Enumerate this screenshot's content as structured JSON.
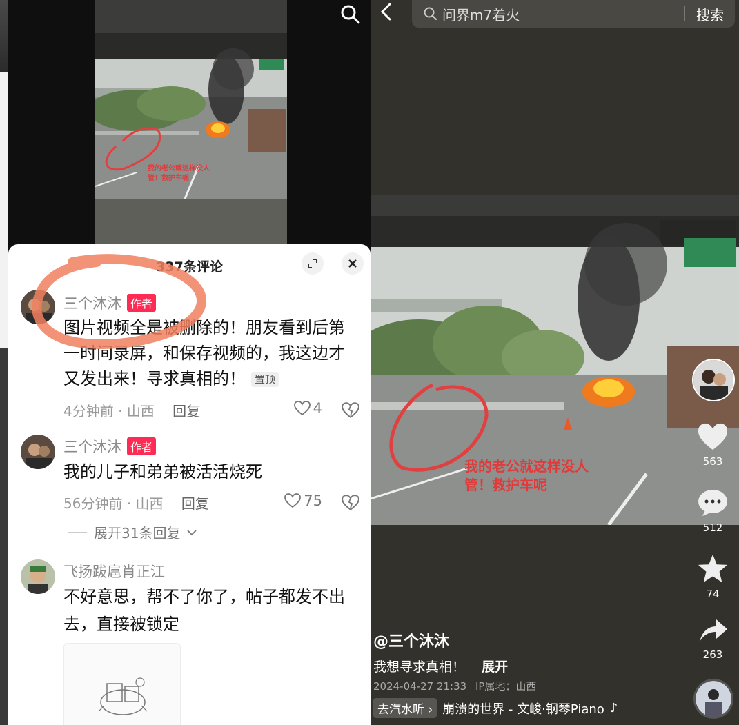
{
  "left": {
    "video_caption": [
      "我的老公就这样没人",
      "管！救护车呢"
    ],
    "comments_panel": {
      "title": "337条评论",
      "comments": [
        {
          "user": "三个沐沐",
          "badge": "作者",
          "text": "图片视频全是被删除的！朋友看到后第一时间录屏，和保存视频的，我这边才又发出来！寻求真相的！",
          "pin_label": "置顶",
          "time": "4分钟前",
          "location": "山西",
          "reply_label": "回复",
          "likes": "4"
        },
        {
          "user": "三个沐沐",
          "badge": "作者",
          "text": "我的儿子和弟弟被活活烧死",
          "time": "56分钟前",
          "location": "山西",
          "reply_label": "回复",
          "likes": "75",
          "expand_replies": "展开31条回复"
        },
        {
          "user": "飞扬跋扈肖正江",
          "text": "不好意思，帮不了你了，帖子都发不出去，直接被锁定"
        }
      ]
    }
  },
  "right": {
    "search": {
      "query": "问界m7着火",
      "button": "搜索"
    },
    "video_caption": [
      "我的老公就这样没人",
      "管！救护车呢"
    ],
    "actions": {
      "likes": "563",
      "comments": "512",
      "favorites": "74",
      "shares": "263"
    },
    "author": "@三个沐沐",
    "description": "我想寻求真相！",
    "expand_label": "展开",
    "timestamp": "2024-04-27 21:33",
    "ip_label": "IP属地：山西",
    "music": {
      "tag": "去汽水听",
      "title": "崩溃的世界 - 文峻·钢琴Piano"
    }
  },
  "colors": {
    "accent_red": "#fe2c55",
    "highlight_circle": "#f07a5a"
  }
}
